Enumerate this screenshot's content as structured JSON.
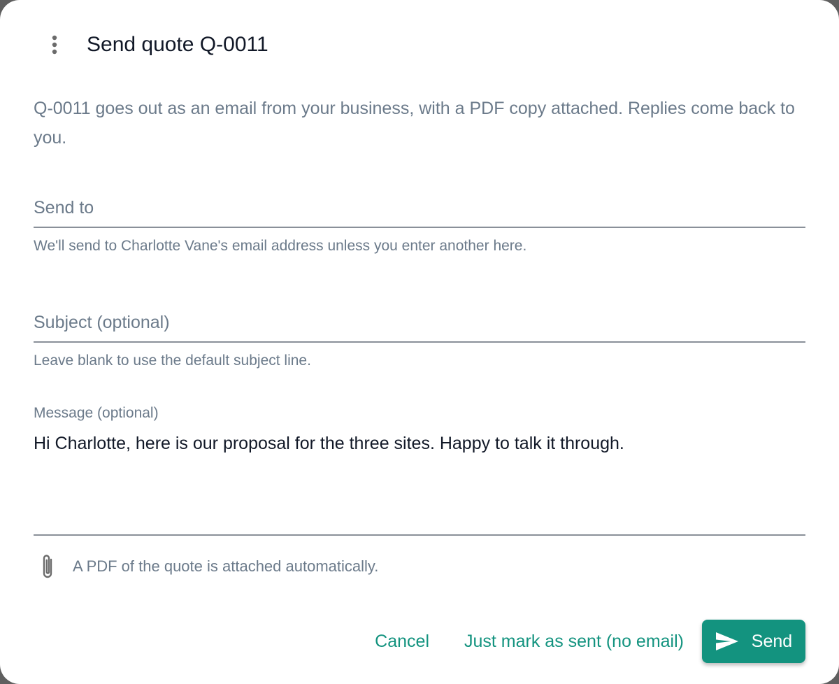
{
  "dialog": {
    "title": "Send quote Q-0011",
    "intro": "Q-0011 goes out as an email from your business, with a PDF copy attached. Replies come back to you.",
    "menu_icon": "more-vertical-icon"
  },
  "send_to": {
    "placeholder": "Send to",
    "value": "",
    "helper": "We'll send to Charlotte Vane's email address unless you enter another here."
  },
  "subject": {
    "placeholder": "Subject (optional)",
    "value": "",
    "helper": "Leave blank to use the default subject line."
  },
  "message": {
    "label": "Message (optional)",
    "value": "Hi Charlotte, here is our proposal for the three sites. Happy to talk it through."
  },
  "attachment": {
    "icon": "paperclip-icon",
    "note": "A PDF of the quote is attached automatically."
  },
  "actions": {
    "cancel_label": "Cancel",
    "mark_sent_label": "Just mark as sent (no email)",
    "send_label": "Send",
    "send_icon": "send-icon"
  },
  "colors": {
    "accent": "#13937f",
    "muted_text": "#6b7a8a",
    "primary_text": "#111827"
  }
}
